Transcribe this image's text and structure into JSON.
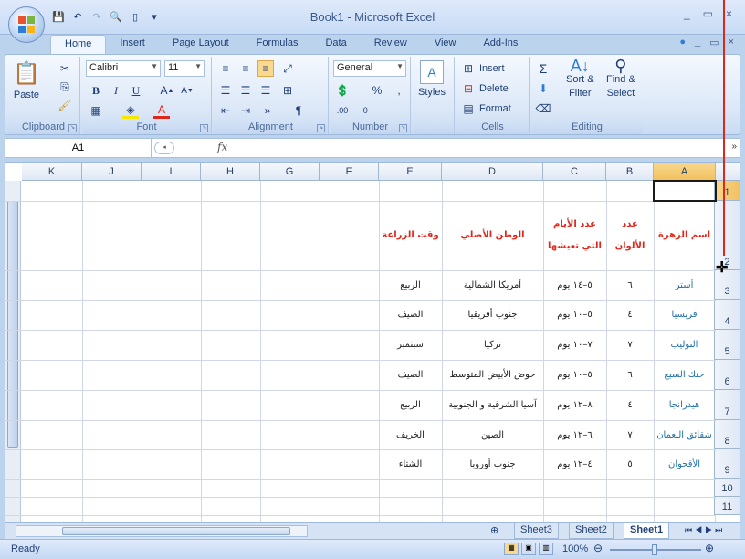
{
  "window": {
    "title": "Book1 - Microsoft Excel",
    "controls": [
      "_",
      "▭",
      "×"
    ],
    "doc_controls": [
      "?",
      "_",
      "▭",
      "×"
    ]
  },
  "tabs": [
    "Home",
    "Insert",
    "Page Layout",
    "Formulas",
    "Data",
    "Review",
    "View",
    "Add-Ins"
  ],
  "ribbon": {
    "clipboard": {
      "label": "Clipboard",
      "paste": "Paste"
    },
    "font": {
      "label": "Font",
      "name": "Calibri",
      "size": "11"
    },
    "alignment": {
      "label": "Alignment"
    },
    "number": {
      "label": "Number",
      "format": "General",
      "percent": "%",
      "comma": ","
    },
    "styles": {
      "label": "Styles"
    },
    "cells": {
      "label": "Cells",
      "insert": "Insert",
      "delete": "Delete",
      "format": "Format"
    },
    "editing": {
      "label": "Editing",
      "sort": "Sort &",
      "filter": "Filter",
      "find": "Find &",
      "select": "Select"
    }
  },
  "formula_bar": {
    "name_box": "A1",
    "fx": "fx",
    "value": ""
  },
  "columns": [
    "K",
    "J",
    "I",
    "H",
    "G",
    "F",
    "E",
    "D",
    "C",
    "B",
    "A"
  ],
  "rows": [
    "1",
    "2",
    "3",
    "4",
    "5",
    "6",
    "7",
    "8",
    "9",
    "10",
    "11"
  ],
  "headers": {
    "a": "اسم الزهرة",
    "b": "عدد الألوان",
    "c": "عدد الأيام التي تعيشها",
    "d": "الوطن الأصلي",
    "e": "وقت الزراعة"
  },
  "table_rows": [
    {
      "a": "أستر",
      "b": "٦",
      "c": "٥–١٤ يوم",
      "d": "أمريكا الشمالية",
      "e": "الربيع"
    },
    {
      "a": "فريسيا",
      "b": "٤",
      "c": "٥–١٠ يوم",
      "d": "جنوب أفريقيا",
      "e": "الصيف"
    },
    {
      "a": "التوليب",
      "b": "٧",
      "c": "٧–١٠ يوم",
      "d": "تركيا",
      "e": "سبتمبر"
    },
    {
      "a": "حنك السبع",
      "b": "٦",
      "c": "٥–١٠ يوم",
      "d": "حوض الأبيض المتوسط",
      "e": "الصيف"
    },
    {
      "a": "هيدرانجا",
      "b": "٤",
      "c": "٨–١٢ يوم",
      "d": "آسيا الشرقية و الجنوبية",
      "e": "الربيع"
    },
    {
      "a": "شقائق النعمان",
      "b": "٧",
      "c": "٦–١٢ يوم",
      "d": "الصين",
      "e": "الخريف"
    },
    {
      "a": "الأقحوان",
      "b": "٥",
      "c": "٤–١٢ يوم",
      "d": "جنوب أوروبا",
      "e": "الشتاء"
    }
  ],
  "sheets": [
    "Sheet3",
    "Sheet2",
    "Sheet1"
  ],
  "status": {
    "ready": "Ready",
    "zoom": "100%"
  },
  "colors": {
    "header_red": "#e0261a",
    "flower_teal": "#1d6ea7",
    "selected_hdr": "#f1c15f"
  }
}
